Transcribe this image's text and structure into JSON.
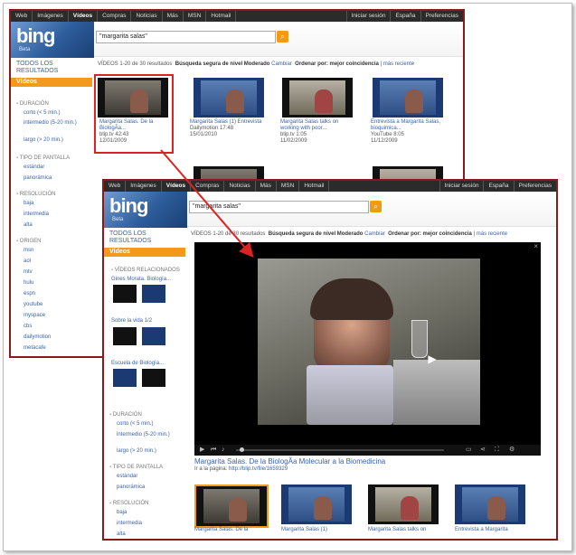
{
  "topbar": {
    "items": [
      "Web",
      "Imágenes",
      "Vídeos",
      "Compras",
      "Noticias",
      "Más",
      "MSN",
      "Hotmail"
    ],
    "right": [
      "Iniciar sesión",
      "España",
      "Preferencias"
    ]
  },
  "brand": {
    "name": "bing",
    "beta": "Beta"
  },
  "search": {
    "query": "\"margarita salas\""
  },
  "sidebar": {
    "all_results": "TODOS LOS RESULTADOS",
    "videos_tab": "Vídeos",
    "sections": {
      "duration": "DURACIÓN",
      "screen": "TIPO DE PANTALLA",
      "resolution": "RESOLUCIÓN",
      "origin": "ORIGEN",
      "related": "VÍDEOS RELACIONADOS"
    },
    "duration": [
      "corto (< 5 min.)",
      "intermedio (5-20 min.)",
      "largo (> 20 min.)"
    ],
    "screen": [
      "estándar",
      "panorámica"
    ],
    "resolution": [
      "baja",
      "intermedia",
      "alta"
    ],
    "origin": [
      "msn",
      "aol",
      "mtv",
      "hulu",
      "espn",
      "youtube",
      "myspace",
      "cbs",
      "dailymotion",
      "metacafe"
    ],
    "related": [
      "Gines Morata. Biología...",
      "Sobre la vida 1/2",
      "Escuela de Biología..."
    ]
  },
  "results_bar": {
    "label": "VÍDEOS",
    "count": "1-20 de 30 resultados",
    "safe": "Búsqueda segura de nivel Moderado",
    "change": "Cambiar",
    "order": "Ordenar por: mejor coincidencia",
    "recent": "más reciente"
  },
  "results": [
    {
      "title": "Margarita Salas. De la BiologÃa...",
      "source": "blip.tv",
      "duration": "42:43",
      "date": "12/01/2009"
    },
    {
      "title": "Margarita Salas (1) Entrevista",
      "source": "Dailymotion",
      "duration": "17:48",
      "date": "15/01/2010"
    },
    {
      "title": "Margarita Salas talks on working with poor...",
      "source": "blip.tv",
      "duration": "1:05",
      "date": "11/02/2009"
    },
    {
      "title": "Entrevista a Margarita Salas, bioquimica...",
      "source": "YouTube",
      "duration": "8:05",
      "date": "11/12/2009"
    }
  ],
  "player": {
    "title": "Margarita Salas. De la BiologÃa Molecular a la Biomedicina",
    "link_label": "Ir a la página:",
    "link": "http://blip.tv/file/1659329",
    "close": "×"
  },
  "bottom_results": [
    "Margarita Salas. De la",
    "Margarita Salas (1)",
    "Margarita Salas talks on",
    "Entrevista a Margarita"
  ],
  "colors": {
    "accent": "#f39a1d",
    "link": "#3b63a8",
    "frame": "#8a1a1a",
    "highlight": "#dd2222"
  }
}
